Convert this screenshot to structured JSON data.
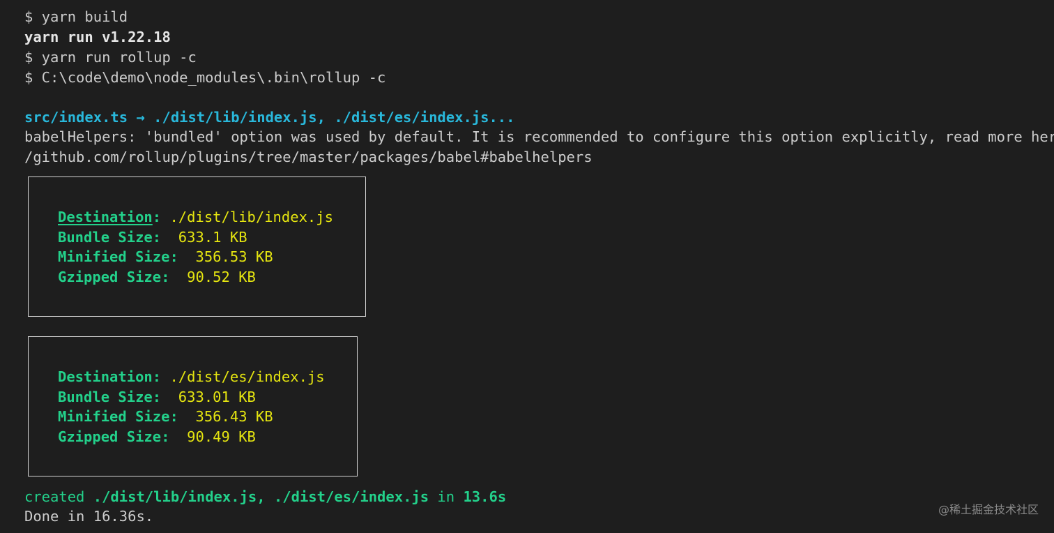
{
  "terminal": {
    "lines": {
      "cmd_build": "$ yarn build",
      "yarn_version": "yarn run v1.22.18",
      "cmd_rollup": "$ yarn run rollup -c",
      "cmd_rollup_path": "$ C:\\code\\demo\\node_modules\\.bin\\rollup -c",
      "bundle_header": "src/index.ts → ./dist/lib/index.js, ./dist/es/index.js...",
      "babel_warning_1": "babelHelpers: 'bundled' option was used by default. It is recommended to configure this option explicitly, read more here: https:",
      "babel_warning_2": "/github.com/rollup/plugins/tree/master/packages/babel#babelhelpers"
    },
    "summary_boxes": [
      {
        "destination_label": "Destination",
        "destination_colon": ": ",
        "destination_value": "./dist/lib/index.js",
        "bundle_label": "Bundle Size:  ",
        "bundle_value": "633.1 KB",
        "minified_label": "Minified Size:  ",
        "minified_value": "356.53 KB",
        "gzipped_label": "Gzipped Size:  ",
        "gzipped_value": "90.52 KB"
      },
      {
        "destination_label": "Destination",
        "destination_colon": ": ",
        "destination_value": "./dist/es/index.js",
        "bundle_label": "Bundle Size:  ",
        "bundle_value": "633.01 KB",
        "minified_label": "Minified Size:  ",
        "minified_value": "356.43 KB",
        "gzipped_label": "Gzipped Size:  ",
        "gzipped_value": "90.49 KB"
      }
    ],
    "created": {
      "word": "created ",
      "outputs": "./dist/lib/index.js, ./dist/es/index.js",
      "in_word": " in ",
      "duration": "13.6s"
    },
    "done": "Done in 16.36s."
  },
  "watermark": "@稀土掘金技术社区",
  "colors": {
    "background": "#1e1e1e",
    "text": "#cccccc",
    "cyan": "#29b8db",
    "green": "#23d18b",
    "yellow": "#e5e510",
    "border": "#d4d4d4"
  }
}
